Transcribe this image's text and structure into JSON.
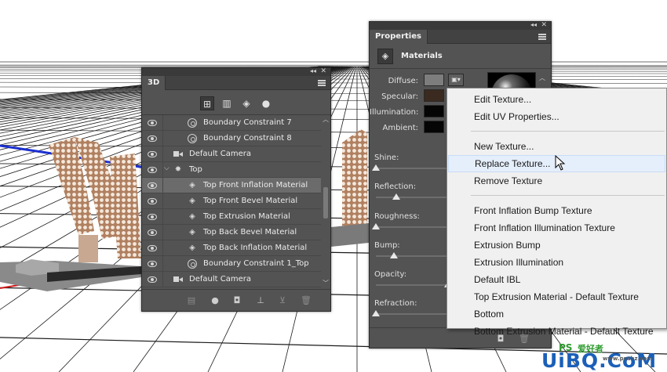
{
  "colors": {
    "panel_bg": "#535353",
    "menu_bg": "#f0f0f0",
    "menu_hover": "#e5eefb",
    "diffuse": "#7d7d7d",
    "specular": "#3a2a1f",
    "illumination": "#050505",
    "ambient": "#050505",
    "watermark_blue": "#1b5fb8",
    "watermark_green": "#2e9b2e"
  },
  "panel3d": {
    "tab": "3D",
    "toolbar_icons": [
      "scene-icon",
      "mesh-icon",
      "material-icon",
      "light-icon"
    ],
    "rows": [
      {
        "label": "Boundary Constraint 7",
        "icon": "circle-icon",
        "indent": 2,
        "selected": false
      },
      {
        "label": "Boundary Constraint 8",
        "icon": "circle-icon",
        "indent": 2,
        "selected": false
      },
      {
        "label": "Default Camera",
        "icon": "camera-icon",
        "indent": 1,
        "selected": false
      },
      {
        "label": "Top",
        "icon": "mesh-star-icon",
        "indent": 1,
        "selected": false,
        "expanded": true
      },
      {
        "label": "Top Front Inflation Material",
        "icon": "material-icon",
        "indent": 2,
        "selected": true
      },
      {
        "label": "Top Front Bevel Material",
        "icon": "material-icon",
        "indent": 2,
        "selected": false
      },
      {
        "label": "Top Extrusion Material",
        "icon": "material-icon",
        "indent": 2,
        "selected": false
      },
      {
        "label": "Top Back Bevel Material",
        "icon": "material-icon",
        "indent": 2,
        "selected": false
      },
      {
        "label": "Top Back Inflation Material",
        "icon": "material-icon",
        "indent": 2,
        "selected": false
      },
      {
        "label": "Boundary Constraint 1_Top",
        "icon": "circle-icon",
        "indent": 2,
        "selected": false
      },
      {
        "label": "Default Camera",
        "icon": "camera-icon",
        "indent": 1,
        "selected": false
      }
    ]
  },
  "properties": {
    "tab": "Properties",
    "header": "Materials",
    "labels": {
      "diffuse": "Diffuse:",
      "specular": "Specular:",
      "illumination": "Illumination:",
      "ambient": "Ambient:"
    },
    "sliders": [
      {
        "label": "Shine:",
        "value": 0.0
      },
      {
        "label": "Reflection:",
        "value": 0.28
      },
      {
        "label": "Roughness:",
        "value": 0.0
      },
      {
        "label": "Bump:",
        "value": 0.25
      },
      {
        "label": "Opacity:",
        "value": 1.0
      },
      {
        "label": "Refraction:",
        "value": 0.0
      }
    ]
  },
  "context_menu": {
    "groups": [
      [
        "Edit Texture...",
        "Edit UV Properties..."
      ],
      [
        "New Texture...",
        "Replace Texture...",
        "Remove Texture"
      ],
      [
        "Front Inflation Bump Texture",
        "Front Inflation Illumination Texture",
        "Extrusion Bump",
        "Extrusion Illumination",
        "Default IBL",
        "Top Extrusion Material - Default Texture",
        "Bottom",
        "Bottom Extrusion Material - Default Texture"
      ]
    ],
    "hovered": "Replace Texture..."
  },
  "watermark": {
    "logo": "UiBQ.CoM",
    "ps": "PS",
    "site": "www.psahz.com",
    "cn": "爱好者"
  }
}
